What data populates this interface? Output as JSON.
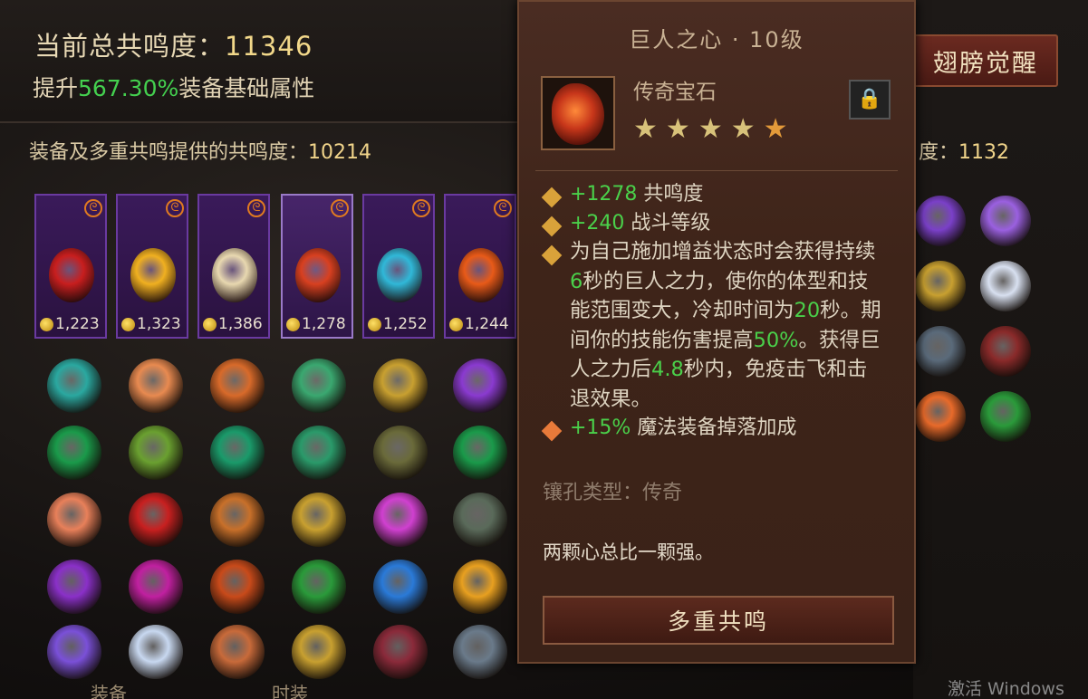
{
  "header": {
    "total_label": "当前总共鸣度：",
    "total_value": "11346",
    "boost_prefix": "提升",
    "boost_pct": "567.30%",
    "boost_suffix": "装备基础属性",
    "equip_label": "装备及多重共鸣提供的共鸣度：",
    "equip_value": "10214",
    "right_label": "度：",
    "right_value": "1132",
    "wing_button": "翅膀觉醒"
  },
  "slots": [
    {
      "value": "1,223",
      "color": "#c81e1e"
    },
    {
      "value": "1,323",
      "color": "#f0b020"
    },
    {
      "value": "1,386",
      "color": "#e8d8b0"
    },
    {
      "value": "1,278",
      "color": "#d84020"
    },
    {
      "value": "1,252",
      "color": "#30b8d8"
    },
    {
      "value": "1,244",
      "color": "#e85a18"
    }
  ],
  "tooltip": {
    "title": "巨人之心 · 10级",
    "type": "传奇宝石",
    "stars_filled": 4,
    "stars_half": 1,
    "stat1_value": "+1278",
    "stat1_label": " 共鸣度",
    "stat2_value": "+240",
    "stat2_label": " 战斗等级",
    "desc_1": "为自己施加增益状态时会获得持续",
    "desc_num1": "6",
    "desc_2": "秒的巨人之力，使你的体型和技能范围变大，冷却时间为",
    "desc_num2": "20",
    "desc_3": "秒。期间你的技能伤害提高",
    "desc_num3": "50%",
    "desc_4": "。获得巨人之力后",
    "desc_num4": "4.8",
    "desc_5": "秒内，免疫击飞和击退效果。",
    "stat3_value": "+15%",
    "stat3_label": " 魔法装备掉落加成",
    "socket": "镶孔类型：传奇",
    "flavor": "两颗心总比一颗强。",
    "button": "多重共鸣"
  },
  "footer": {
    "watermark": "激活 Windows",
    "tab1": "装备",
    "tab2": "时装"
  }
}
